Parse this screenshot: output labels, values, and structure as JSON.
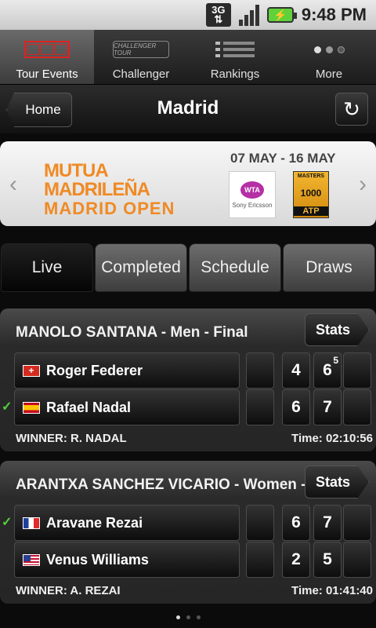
{
  "status_bar": {
    "network": "3G",
    "time": "9:48 PM"
  },
  "nav": {
    "items": [
      {
        "label": "Tour Events",
        "icon": "tour-events-icon",
        "active": true
      },
      {
        "label": "Challenger",
        "icon": "challenger-icon",
        "badge": "CHALLENGER TOUR"
      },
      {
        "label": "Rankings",
        "icon": "rankings-icon"
      },
      {
        "label": "More",
        "icon": "more-icon"
      }
    ]
  },
  "header": {
    "back_label": "Home",
    "title": "Madrid"
  },
  "banner": {
    "logo_line1": "MUTUA MADRILEÑA",
    "logo_line2": "MADRID OPEN",
    "dates": "07 MAY - 16 MAY",
    "wta_label": "WTA",
    "sponsor_label": "Sony Ericsson",
    "masters_top": "MASTERS",
    "masters_num": "1000",
    "masters_atp": "ATP"
  },
  "tabs": [
    "Live",
    "Completed",
    "Schedule",
    "Draws"
  ],
  "matches": [
    {
      "title": "MANOLO SANTANA - Men - Final",
      "stats_label": "Stats",
      "players": [
        {
          "name": "Roger Federer",
          "flag": "switzerland",
          "winner": false,
          "set1": "4",
          "set2": "6",
          "tiebreak": "5"
        },
        {
          "name": "Rafael Nadal",
          "flag": "spain",
          "winner": true,
          "set1": "6",
          "set2": "7",
          "tiebreak": ""
        }
      ],
      "winner_text": "WINNER: R. NADAL",
      "time_text": "Time: 02:10:56"
    },
    {
      "title": "ARANTXA SANCHEZ VICARIO - Women - Fi...",
      "stats_label": "Stats",
      "players": [
        {
          "name": "Aravane Rezai",
          "flag": "france",
          "winner": true,
          "set1": "6",
          "set2": "7",
          "tiebreak": ""
        },
        {
          "name": "Venus Williams",
          "flag": "usa",
          "winner": false,
          "set1": "2",
          "set2": "5",
          "tiebreak": ""
        }
      ],
      "winner_text": "WINNER: A. REZAI",
      "time_text": "Time: 01:41:40"
    }
  ],
  "colors": {
    "accent_orange": "#f08a24",
    "winner_check": "#53d13a",
    "battery": "#5fd13b"
  }
}
